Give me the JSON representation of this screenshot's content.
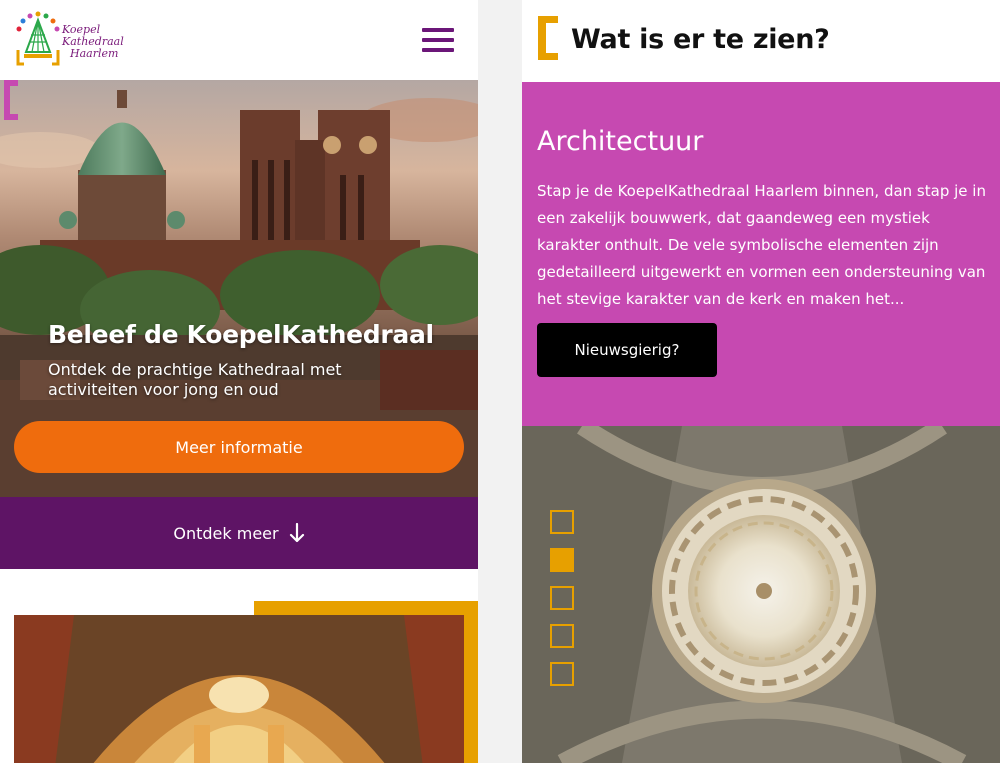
{
  "left": {
    "logo_text": [
      "Koepel",
      "Kathedraal",
      "Haarlem"
    ],
    "hero": {
      "title": "Beleef de KoepelKathedraal",
      "subtitle": "Ontdek de prachtige Kathedraal met activiteiten voor jong en oud",
      "button_label": "Meer informatie"
    },
    "ontdek_label": "Ontdek meer"
  },
  "right": {
    "section_title": "Wat is er te zien?",
    "panel": {
      "title": "Architectuur",
      "body": "Stap je de KoepelKathedraal Haarlem binnen, dan stap je in een zakelijk bouwwerk, dat gaandeweg een mystiek karakter onthult. De vele symbolische elementen zijn gedetailleerd uitgewerkt en vormen een ondersteuning van het stevige karakter van de kerk en maken het...",
      "button_label": "Nieuwsgierig?"
    },
    "pager": {
      "count": 5,
      "active_index": 1
    }
  },
  "colors": {
    "purple": "#5e1465",
    "orange": "#ef6c0d",
    "pink": "#c649b1",
    "gold": "#e7a000",
    "magenta_bracket": "#c649b1"
  },
  "icons": [
    "menu-icon",
    "arrow-down-icon",
    "logo-icon"
  ]
}
